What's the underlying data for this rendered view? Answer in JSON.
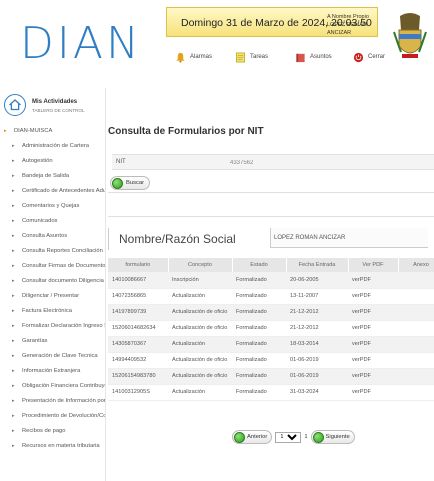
{
  "header": {
    "logo": "DIAN",
    "date": "Domingo 31 de Marzo de 2024, 20:03:50",
    "user_line1": "A Nombre Propio",
    "user_line2": "LOPEZ ROMAN ANCIZAR",
    "tools": [
      {
        "label": "Alarmas",
        "icon": "bell-icon",
        "color": "#e3a21a"
      },
      {
        "label": "Tareas",
        "icon": "note-icon",
        "color": "#e6d64a"
      },
      {
        "label": "Asuntos",
        "icon": "folder-icon",
        "color": "#d9534f"
      },
      {
        "label": "Cerrar",
        "icon": "power-icon",
        "color": "#cc1f1f"
      }
    ]
  },
  "sidebar": {
    "title": "Mis Actividades",
    "subtitle": "TABLERO DE CONTROL",
    "items": [
      "DIAN-MUISCA",
      "Administración de Cartera",
      "Autogestión",
      "Bandeja de Salida",
      "Certificado de Antecedentes Adu",
      "Comentarios y Quejas",
      "Comunicados",
      "Consulta Asuntos",
      "Consulta Reportes Conciliación F",
      "Consultar Firmas de Documento",
      "Consultar documento Diligencia",
      "Diligenciar / Presentar",
      "Factura Electrónica",
      "Formalizar Declaración Ingreso S",
      "Garantías",
      "Generación de Clave Tecnica",
      "Información Extranjera",
      "Obligación Financiera Contribuye",
      "Presentación de Información por",
      "Procedimiento de Devolución/Co",
      "Recibos de pago",
      "Recursos en materia tributaria"
    ]
  },
  "main": {
    "title": "Consulta de Formularios por NIT",
    "nit_label": "NIT",
    "nit_value": "4337562",
    "buscar_label": "Buscar",
    "nombre_label": "Nombre/Razón Social",
    "nombre_value": "LOPEZ ROMAN ANCIZAR",
    "columns": [
      "formulario",
      "Concepto",
      "Estado",
      "Fecha Entrada",
      "Ver PDF",
      "Anexo"
    ],
    "rows": [
      [
        "14010086667",
        "Inscripción",
        "Formalizado",
        "20-06-2005",
        "verPDF",
        ""
      ],
      [
        "14072356865",
        "Actualización",
        "Formalizado",
        "13-11-2007",
        "verPDF",
        ""
      ],
      [
        "14197899739",
        "Actualización de oficio",
        "Formalizado",
        "21-12-2012",
        "verPDF",
        ""
      ],
      [
        "15206014682634",
        "Actualización de oficio",
        "Formalizado",
        "21-12-2012",
        "verPDF",
        ""
      ],
      [
        "14305870367",
        "Actualización",
        "Formalizado",
        "18-03-2014",
        "verPDF",
        ""
      ],
      [
        "14994409532",
        "Actualización de oficio",
        "Formalizado",
        "01-06-2019",
        "verPDF",
        ""
      ],
      [
        "15206154983780",
        "Actualización de oficio",
        "Formalizado",
        "01-06-2019",
        "verPDF",
        ""
      ],
      [
        "14100312905S",
        "Actualización",
        "Formalizado",
        "31-03-2024",
        "verPDF",
        ""
      ]
    ],
    "pager": {
      "prev": "Anterior",
      "page": "1",
      "of": "1",
      "next": "Siguiente"
    }
  }
}
